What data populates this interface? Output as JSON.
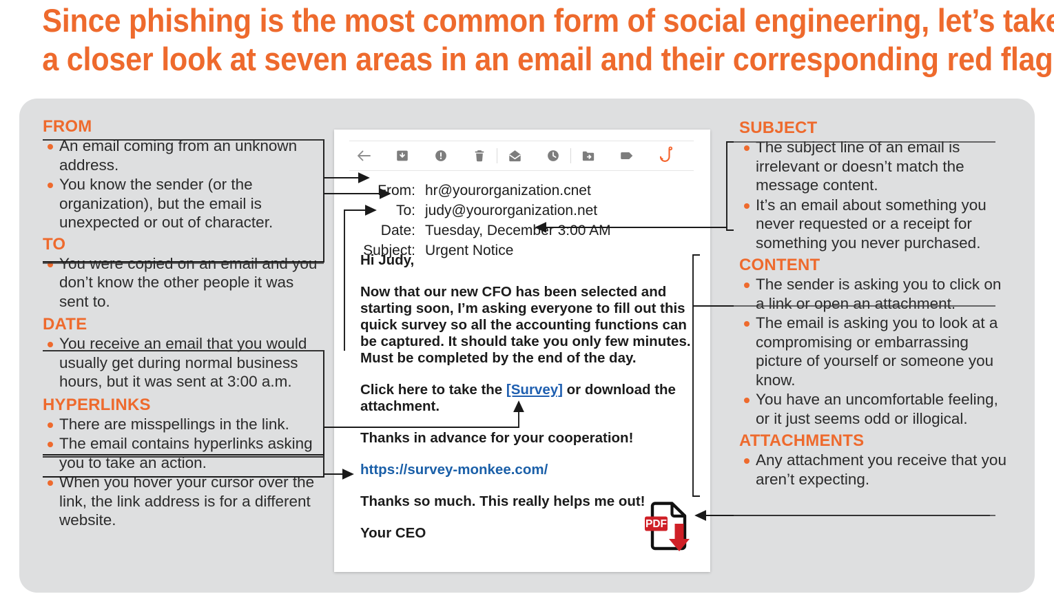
{
  "title": {
    "line1": "Since phishing is the most common form of social engineering, let’s take",
    "line2": "a closer look at seven areas in an email and their corresponding red flags."
  },
  "accent_color": "#ee6a2d",
  "panel_color": "#dedfe0",
  "left_sections": [
    {
      "heading": "FROM",
      "bullets": [
        "An email coming from an unknown address.",
        "You know the sender (or the organization), but the email is unexpected or out of character."
      ]
    },
    {
      "heading": "TO",
      "bullets": [
        "You were copied on an email and you don’t know the other people it was sent to."
      ]
    },
    {
      "heading": "DATE",
      "bullets": [
        "You receive an email that you would usually get during normal business hours, but it was sent at 3:00 a.m."
      ]
    },
    {
      "heading": "HYPERLINKS",
      "bullets": [
        "There are misspellings in the link.",
        "The email contains hyperlinks asking you to take an action.",
        "When you hover your cursor over the link, the link address is for a different website."
      ]
    }
  ],
  "right_sections": [
    {
      "heading": "SUBJECT",
      "bullets": [
        "The subject line of an email is irrelevant or doesn’t match the message content.",
        "It’s an email about something you never requested or a receipt for something you never purchased."
      ]
    },
    {
      "heading": "CONTENT",
      "bullets": [
        "The sender is asking you to click on a link or open an attachment.",
        "The email is asking you to look at a compromising or embarrassing picture of yourself or someone you know.",
        "You have an uncomfortable feeling, or it just seems odd or illogical."
      ]
    },
    {
      "heading": "ATTACHMENTS",
      "bullets": [
        "Any attachment you receive that you aren’t expecting."
      ]
    }
  ],
  "email": {
    "toolbar_icons": [
      "back-arrow-icon",
      "archive-icon",
      "report-spam-icon",
      "delete-icon",
      "mark-unread-icon",
      "snooze-clock-icon",
      "move-to-folder-icon",
      "label-tag-icon",
      "phishing-hook-icon"
    ],
    "headers": {
      "from_label": "From:",
      "from_value": "hr@yourorganization.cnet",
      "to_label": "To:",
      "to_value": "judy@yourorganization.net",
      "date_label": "Date:",
      "date_value": "Tuesday, December 3:00 AM",
      "subject_label": "Subject:",
      "subject_value": "Urgent Notice"
    },
    "body": {
      "greeting": "Hi Judy,",
      "paragraph1": "Now that our new CFO has been selected and starting soon, I’m asking everyone to fill out this quick survey so all the accounting functions can be captured. It should take you only few minutes. Must be completed by the end of the day.",
      "cta_before": "Click here to take the ",
      "cta_link": "[Survey]",
      "cta_after": " or download the attachment.",
      "thanks1": "Thanks in advance for your cooperation!",
      "url": "https://survey-monkee.com/",
      "thanks2": "Thanks so much. This really helps me out!",
      "signature": "Your CEO"
    },
    "attachment": {
      "type_label": "PDF",
      "icon": "pdf-download-icon"
    }
  }
}
